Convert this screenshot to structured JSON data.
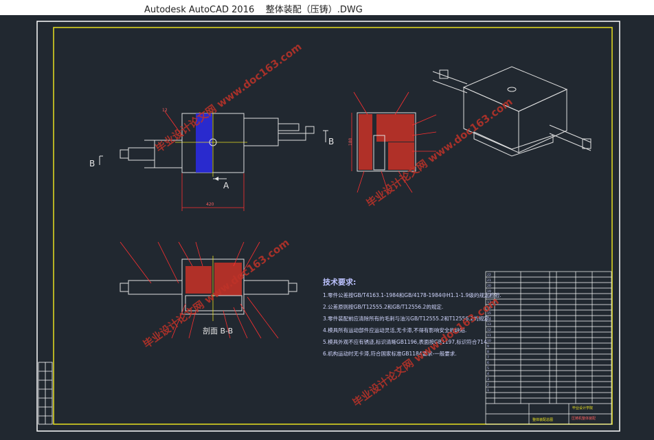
{
  "window": {
    "app_name": "Autodesk AutoCAD 2016",
    "file_name": "整体装配（压铸）.DWG"
  },
  "labels": {
    "view_b_left": "B",
    "view_b_right": "B",
    "view_a": "A",
    "section_bb": "剖面 B-B",
    "dim_bottom_front": "420",
    "dim_side": "180",
    "title_block_company": "毕业设计学院",
    "title_block_name": "压铸机整体装配",
    "title_block_drawing_no": "整体装配总图"
  },
  "tech_requirements": {
    "heading": "技术要求:",
    "items": [
      "1.零件公差按GB/T4163.1-1984和GB/4178-1984中H1.1-1.9级的规定检验.",
      "2.公差原则按GB/T12555.2和GB/T12556.2的规定.",
      "3.零件装配前应清除所有的毛刺与油污GB/T12555.2和T12556.2的规定.",
      "4.模具所有运动部件应运动灵活,无卡滞,不得有影响安全的缺陷.",
      "5.模具外观不应有锈迹,标识清晰GB1196,表面按GB1197,标识符合714.",
      "6.机构运动时无卡滞,符合国家标准GB1184要求-一般要求."
    ]
  },
  "watermarks": {
    "text": "毕业设计论文网 www.doc163.com"
  },
  "colors": {
    "background": "#212830",
    "frame_white": "#ffffff",
    "frame_yellow": "#e8e020",
    "section_red": "#b03028",
    "blue_fill": "#2a2ae0",
    "leader_red": "#ff3030",
    "text_blue": "#c8ccff"
  }
}
